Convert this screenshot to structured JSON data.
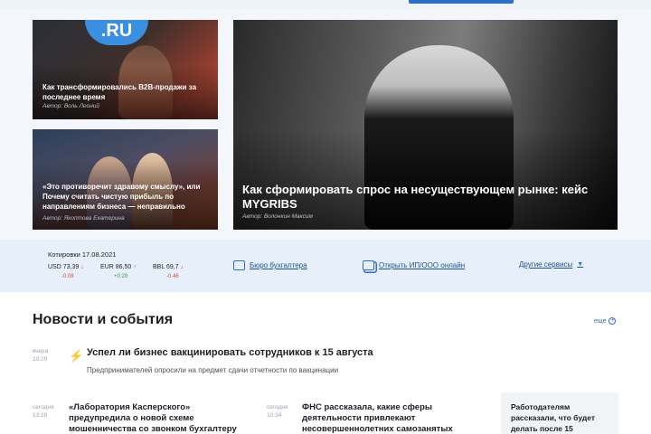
{
  "hero": {
    "card1": {
      "title": "Как трансформировались B2B-продажи за последнее время",
      "author": "Автор: Воль Леоний",
      "logo_text": ".RU"
    },
    "card2": {
      "title": "«Это противоречит здравому смыслу», или Почему считать чистую прибыль по направлениям бизнеса — неправильно",
      "author": "Автор: Якоптова Екатерина"
    },
    "card_big": {
      "title": "Как сформировать спрос на несуществующем рынке: кейс MYGRIBS",
      "author": "Автор: Волонкин Максим"
    }
  },
  "services": {
    "quotes_title": "Котировки 17.08.2021",
    "quotes": [
      {
        "name": "USD",
        "value": "73,39",
        "direction": "down",
        "change": "-0.08"
      },
      {
        "name": "EUR",
        "value": "86,50",
        "direction": "up",
        "change": "+0.29"
      },
      {
        "name": "BBL",
        "value": "69,7",
        "direction": "down",
        "change": "-0.46"
      }
    ],
    "links": [
      {
        "label": "Бюро бухгалтера",
        "icon": "monitor-icon"
      },
      {
        "label": "Открыть ИП/ООО онлайн",
        "icon": "documents-icon"
      },
      {
        "label": "Другие сервисы",
        "icon": "chevron-down-icon"
      }
    ],
    "colors": {
      "down": "#e0443a",
      "up": "#2ea043",
      "link": "#1e4f9a"
    }
  },
  "news": {
    "section_title": "Новости и события",
    "more_label": "еще",
    "items": [
      {
        "day": "вчера",
        "time": "10:29",
        "title": "Успел ли бизнес вакцинировать сотрудников к 15 августа",
        "subtitle": "Предпринимателей опросили на предмет сдачи отчетности по вакцинации",
        "icon": "lightning-icon"
      },
      {
        "day": "сегодня",
        "time": "13:28",
        "title": "«Лаборатория Касперского» предупредила о новой схеме мошенничества со звонком бухгалтеру"
      },
      {
        "day": "сегодня",
        "time": "10:34",
        "title": "ФНС рассказала, какие сферы деятельности привлекают несовершеннолетних самозанятых"
      },
      {
        "title": "Работодателям рассказали, что будет делать после 15"
      }
    ]
  }
}
